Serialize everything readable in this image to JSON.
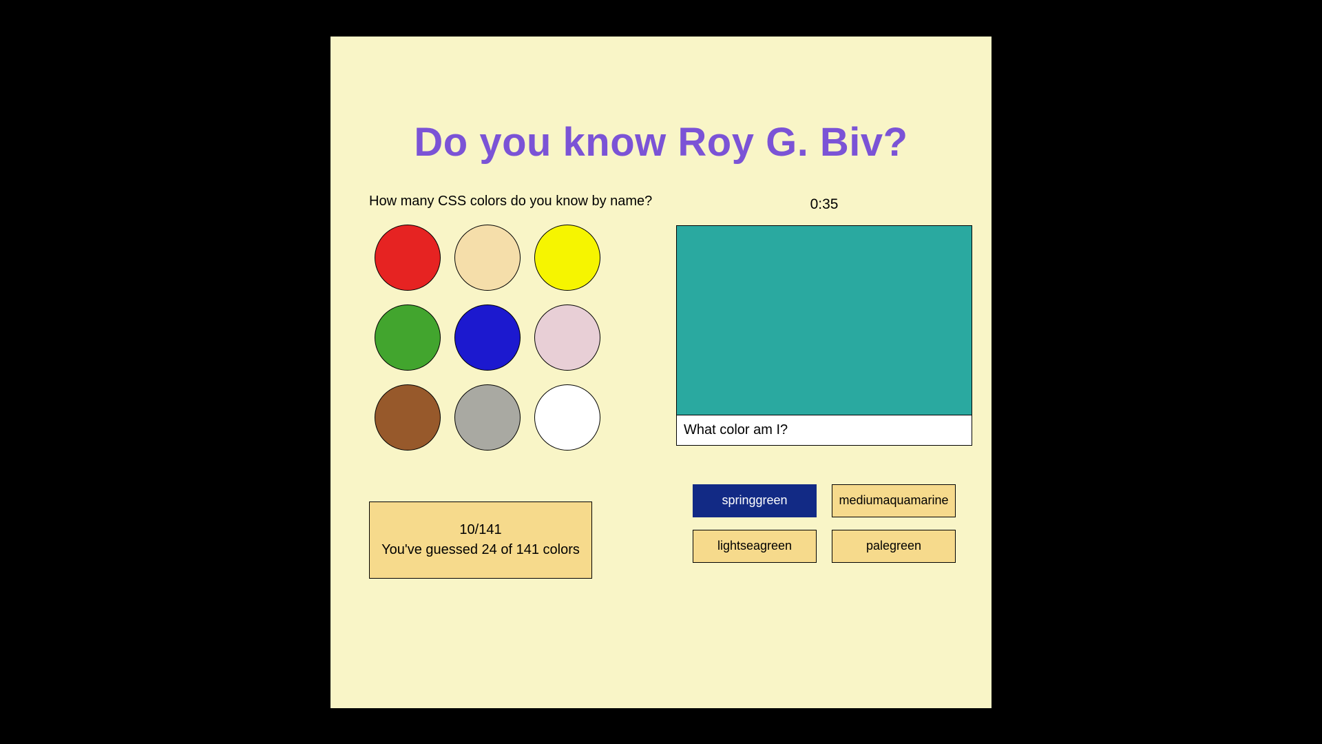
{
  "title": "Do you know Roy G. Biv?",
  "subtitle": "How many CSS colors do you know by name?",
  "swatch_colors": [
    "#e62322",
    "#f5deaa",
    "#f6f500",
    "#42a52e",
    "#1c19cf",
    "#e8cfd6",
    "#97592b",
    "#a9a9a2",
    "#ffffff"
  ],
  "score": {
    "progress": "10/141",
    "summary": "You've guessed 24 of 141 colors"
  },
  "timer": "0:35",
  "question": {
    "swatch_color": "#2aa9a0",
    "prompt": "What color am I?"
  },
  "answers": [
    {
      "label": "springgreen",
      "selected": true
    },
    {
      "label": "mediumaquamarine",
      "selected": false
    },
    {
      "label": "lightseagreen",
      "selected": false
    },
    {
      "label": "palegreen",
      "selected": false
    }
  ]
}
